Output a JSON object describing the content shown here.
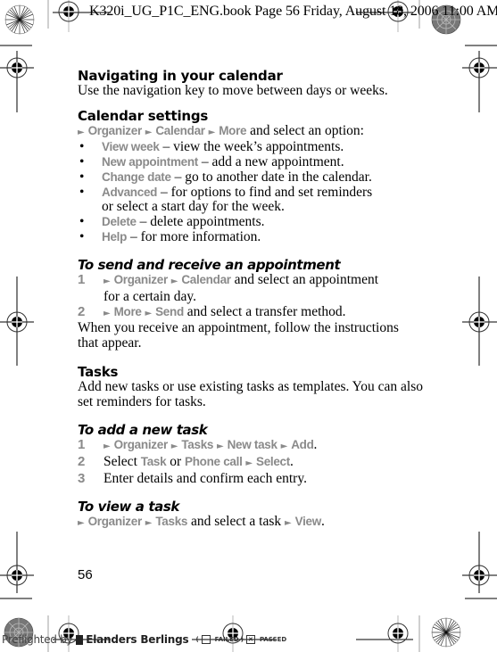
{
  "print_header": {
    "text": "K320i_UG_P1C_ENG.book  Page 56  Friday, August 18, 2006  11:00 AM"
  },
  "sections": {
    "navigating": {
      "title": "Navigating in your calendar",
      "body": "Use the navigation key to move between days or weeks."
    },
    "settings": {
      "title": "Calendar settings",
      "path": [
        "Organizer",
        "Calendar",
        "More"
      ],
      "path_suffix": " and select an option:",
      "options": [
        {
          "label": "View week",
          "desc": " – view the week’s appointments."
        },
        {
          "label": "New appointment",
          "desc": " – add a new appointment."
        },
        {
          "label": "Change date",
          "desc": " – go to another date in the calendar."
        },
        {
          "label": "Advanced",
          "desc": " – for options to find and set reminders",
          "desc2": "or select a start day for the week."
        },
        {
          "label": "Delete",
          "desc": " – delete appointments."
        },
        {
          "label": "Help",
          "desc": " – for more information."
        }
      ]
    },
    "send_receive": {
      "title": "To send and receive an appointment",
      "steps": [
        {
          "num": "1",
          "path": [
            "Organizer",
            "Calendar"
          ],
          "text": " and select an appointment",
          "text2": "for a certain day."
        },
        {
          "num": "2",
          "path": [
            "More",
            "Send"
          ],
          "text": " and select a transfer method."
        }
      ],
      "note_line1": "When you receive an appointment, follow the instructions",
      "note_line2": "that appear."
    },
    "tasks": {
      "title": "Tasks",
      "body_line1": "Add new tasks or use existing tasks as templates. You can also",
      "body_line2": "set reminders for tasks."
    },
    "add_task": {
      "title": "To add a new task",
      "steps": [
        {
          "num": "1",
          "path": [
            "Organizer",
            "Tasks",
            "New task",
            "Add"
          ],
          "end": "."
        },
        {
          "num": "2",
          "pre": "Select ",
          "opt1": "Task",
          "mid": " or ",
          "opt2": "Phone call",
          "opt3": "Select",
          "end": "."
        },
        {
          "num": "3",
          "text": "Enter details and confirm each entry."
        }
      ]
    },
    "view_task": {
      "title": "To view a task",
      "path": [
        "Organizer",
        "Tasks"
      ],
      "mid": " and select a task ",
      "final": "View",
      "end": "."
    }
  },
  "page_number": "56",
  "preflight": {
    "prefix": "Preflighted by",
    "company": "Elanders Berlings",
    "failed_label": "FAILED",
    "passed_label": "PASSED",
    "failed_checked": false,
    "passed_checked": true
  },
  "colors": {
    "menu_grey": "#8a8a8a"
  }
}
